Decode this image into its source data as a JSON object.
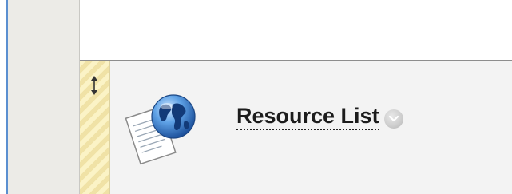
{
  "content_item": {
    "title": "Resource List",
    "icon": "globe-document-icon",
    "menu_icon": "chevron-down-icon",
    "drag_icon": "vertical-drag-arrows-icon"
  },
  "colors": {
    "left_rail": "#ecebe7",
    "content_background": "#f3f3f3",
    "drag_strip_light": "#fbf3c6",
    "drag_strip_dark": "#f0e2a6",
    "frame_border": "#5b8fd0"
  }
}
